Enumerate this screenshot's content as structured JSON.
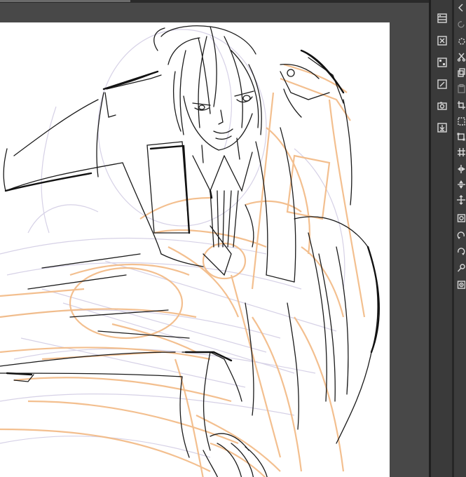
{
  "app": {
    "colors": {
      "background": "#333333",
      "canvas_backdrop": "#484848",
      "paper": "#ffffff",
      "line_art": "#1a1a1a",
      "sketch_orange": "#f2b983",
      "sketch_lavender": "#c9c3de"
    }
  },
  "panel_buttons": [
    {
      "icon": "layer-panel-icon"
    },
    {
      "icon": "delete-layer-icon"
    },
    {
      "icon": "layer-settings-icon"
    },
    {
      "icon": "edit-layer-icon"
    },
    {
      "icon": "camera-icon"
    },
    {
      "icon": "import-icon"
    }
  ],
  "toolbar": [
    {
      "icon": "arrow-left-icon"
    },
    {
      "icon": "redo-icon"
    },
    {
      "icon": "lasso-select-icon"
    },
    {
      "icon": "cut-icon"
    },
    {
      "icon": "copy-icon"
    },
    {
      "icon": "paste-icon"
    },
    {
      "icon": "crop-icon"
    },
    {
      "icon": "marquee-icon"
    },
    {
      "icon": "transform-icon"
    },
    {
      "icon": "grid-icon"
    },
    {
      "icon": "flip-horizontal-icon"
    },
    {
      "icon": "flip-vertical-icon"
    },
    {
      "icon": "move-icon"
    },
    {
      "icon": "zoom-icon"
    },
    {
      "icon": "rotate-left-icon"
    },
    {
      "icon": "rotate-right-icon"
    },
    {
      "icon": "wrench-icon"
    },
    {
      "icon": "gear-icon"
    }
  ]
}
